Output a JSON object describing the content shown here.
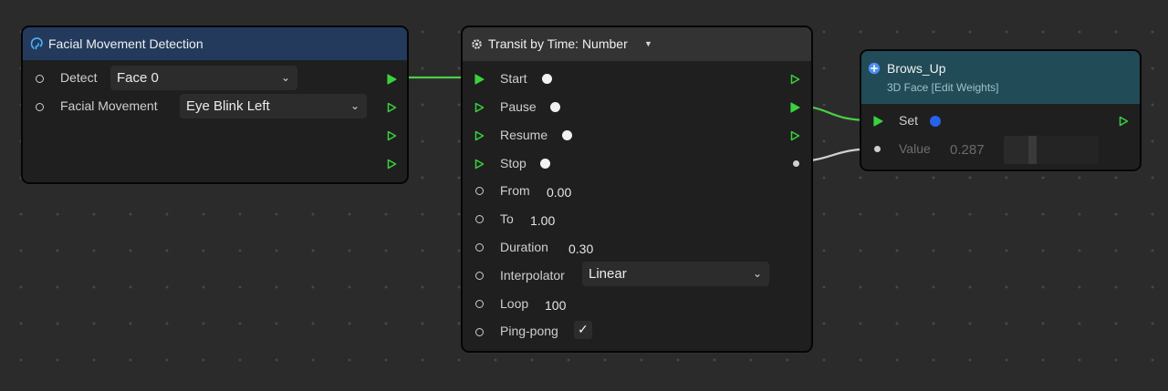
{
  "colors": {
    "canvas": "#2b2b2b",
    "node_body": "#1f1f1f",
    "header_blue": "#233a5c",
    "header_gray": "#333333",
    "header_teal": "#214b57",
    "flow_green": "#38d33c",
    "wire_green": "#4ecb47",
    "wire_white": "#d0d0d0",
    "pulse_blue": "#2563eb"
  },
  "facial_node": {
    "title": "Facial Movement Detection",
    "icon": "face-icon",
    "rows": [
      {
        "label": "Detect",
        "value": "Face 0"
      },
      {
        "label": "Facial Movement",
        "value": "Eye Blink Left"
      }
    ],
    "outputs": 4
  },
  "transit_node": {
    "title": "Transit by Time: Number",
    "icon": "gear-icon",
    "flow_inputs": [
      "Start",
      "Pause",
      "Resume",
      "Stop"
    ],
    "from": {
      "label": "From",
      "value": "0.00"
    },
    "to": {
      "label": "To",
      "value": "1.00"
    },
    "duration": {
      "label": "Duration",
      "value": "0.30"
    },
    "interpolator": {
      "label": "Interpolator",
      "value": "Linear"
    },
    "loop": {
      "label": "Loop",
      "value": "100"
    },
    "pingpong": {
      "label": "Ping-pong",
      "checked": true,
      "glyph": "✓"
    }
  },
  "brows_node": {
    "title": "Brows_Up",
    "subtitle": "3D Face [Edit Weights]",
    "icon": "plus-circle-icon",
    "set_label": "Set",
    "value_label": "Value",
    "value": "0.287",
    "slider_fraction": 0.287
  }
}
